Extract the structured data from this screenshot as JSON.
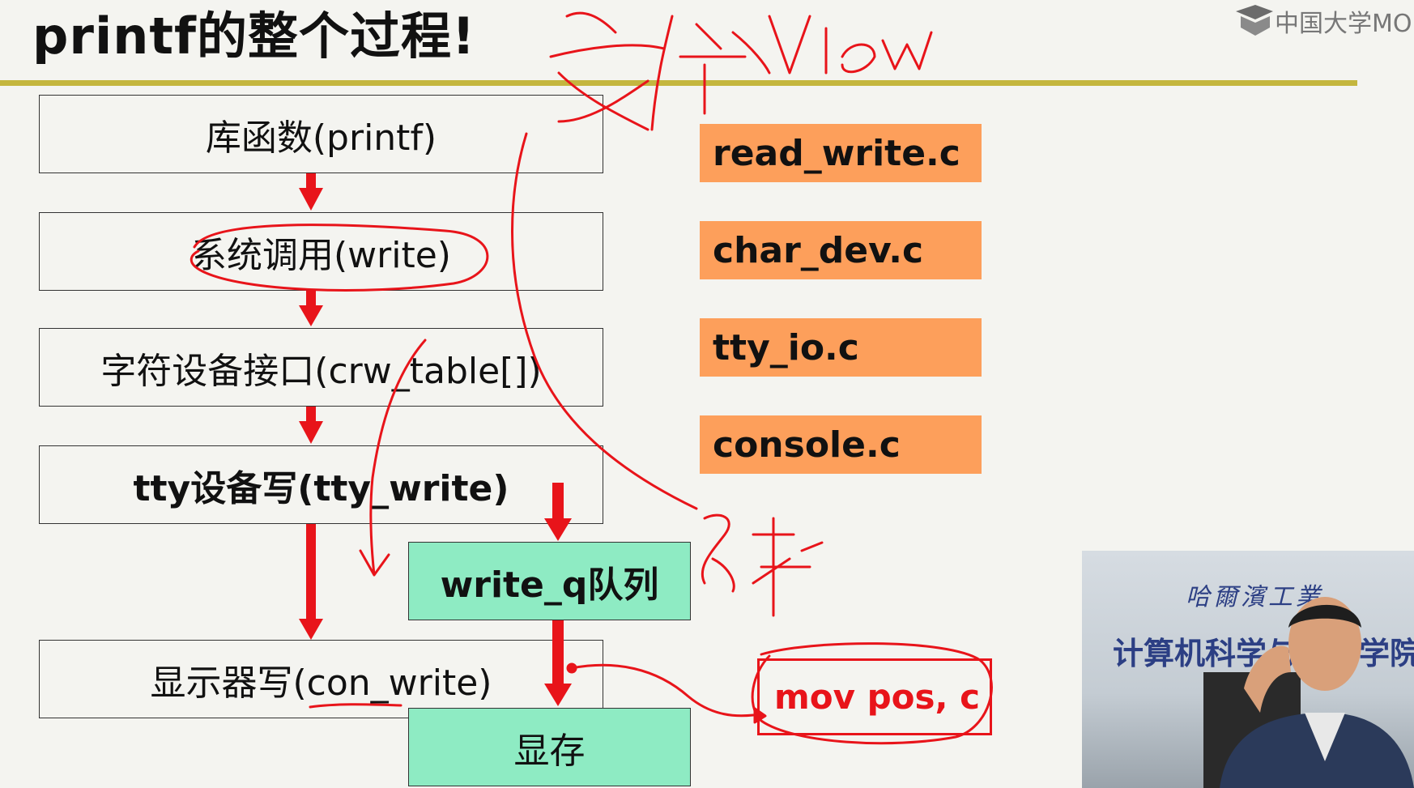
{
  "slide": {
    "title": "printf的整个过程!",
    "logo_text": "中国大学MO"
  },
  "flow": {
    "library": "库函数(printf)",
    "syscall": "系统调用(write)",
    "chardev": "字符设备接口(crw_table[])",
    "tty_write": "tty设备写(tty_write)",
    "write_q": "write_q队列",
    "con_write": "显示器写(con_write)",
    "vram": "显存"
  },
  "files": [
    "read_write.c",
    "char_dev.c",
    "tty_io.c",
    "console.c"
  ],
  "annotation": {
    "mov": "mov pos, c"
  },
  "camera": {
    "sign_top": "哈爾濱工業",
    "sign_main": "计算机科学与技术学院"
  },
  "colors": {
    "arrow_red": "#e8141a",
    "ink_red": "#e8141a",
    "file_orange": "#fd9f5b",
    "queue_green": "#8eebc3",
    "rule_olive": "#c4b63e"
  }
}
